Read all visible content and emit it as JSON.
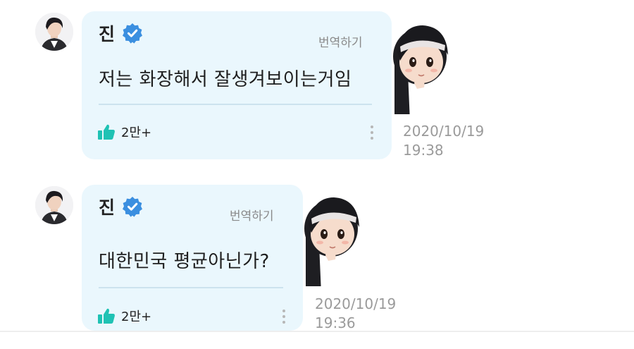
{
  "posts": [
    {
      "author": "진",
      "verified_icon": "verified-check-icon",
      "translate_label": "번역하기",
      "message": "저는 화장해서 잘생겨보이는거임",
      "likes": "2만+",
      "timestamp_date": "2020/10/19",
      "timestamp_time": "19:38"
    },
    {
      "author": "진",
      "verified_icon": "verified-check-icon",
      "translate_label": "번역하기",
      "message": "대한민국 평균아닌가?",
      "likes": "2만+",
      "timestamp_date": "2020/10/19",
      "timestamp_time": "19:36"
    }
  ],
  "colors": {
    "bubble_bg": "#eaf7fd",
    "verified_blue": "#3b8fe0",
    "like_teal": "#1fc2b4",
    "timestamp_gray": "#9a9a9a"
  }
}
